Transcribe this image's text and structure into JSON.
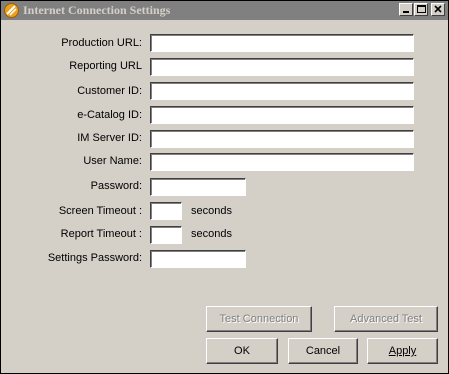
{
  "window": {
    "title": "Internet Connection Settings",
    "icon": "app-logo-icon",
    "controls": [
      "minimize-icon",
      "maximize-icon",
      "close-icon"
    ]
  },
  "form": {
    "production_url": {
      "label": "Production URL:",
      "value": ""
    },
    "reporting_url": {
      "label": "Reporting URL",
      "value": ""
    },
    "customer_id": {
      "label": "Customer ID:",
      "value": ""
    },
    "ecatalog_id": {
      "label": "e-Catalog ID:",
      "value": ""
    },
    "im_server_id": {
      "label": "IM Server ID:",
      "value": ""
    },
    "user_name": {
      "label": "User Name:",
      "value": ""
    },
    "password": {
      "label": "Password:",
      "value": ""
    },
    "screen_timeout": {
      "label": "Screen Timeout :",
      "value": "",
      "unit": "seconds"
    },
    "report_timeout": {
      "label": "Report Timeout :",
      "value": "",
      "unit": "seconds"
    },
    "settings_password": {
      "label": "Settings Password:",
      "value": ""
    }
  },
  "buttons": {
    "test_connection": "Test Connection",
    "advanced_test": "Advanced Test",
    "ok": "OK",
    "cancel": "Cancel",
    "apply": "Apply"
  },
  "colors": {
    "titlebar_inactive": "#808080",
    "dialog_face": "#d4d0c8"
  }
}
